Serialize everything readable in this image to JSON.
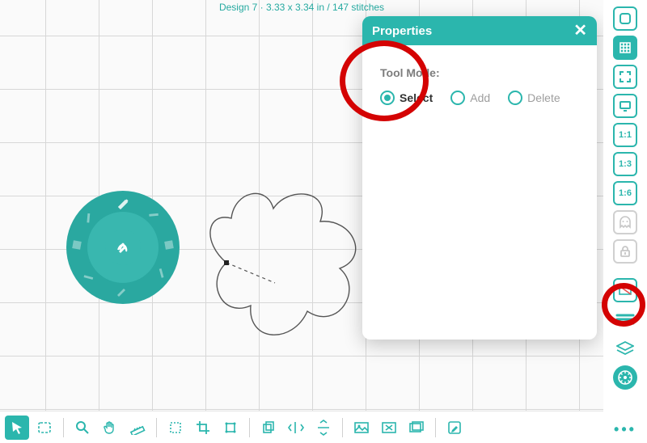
{
  "design_info": "Design 7 · 3.33 x 3.34 in / 147 stitches",
  "panel": {
    "title": "Properties",
    "tool_mode_label": "Tool Mode:",
    "modes": [
      {
        "label": "Select",
        "selected": true
      },
      {
        "label": "Add",
        "selected": false
      },
      {
        "label": "Delete",
        "selected": false
      }
    ]
  },
  "side_tools": [
    {
      "name": "outline-box",
      "label": "",
      "type": "rect"
    },
    {
      "name": "grid",
      "label": "",
      "type": "grid",
      "active": true
    },
    {
      "name": "fit-screen",
      "label": "",
      "type": "fit"
    },
    {
      "name": "monitor",
      "label": "",
      "type": "monitor"
    },
    {
      "name": "zoom-1-1",
      "label": "1:1",
      "type": "text"
    },
    {
      "name": "zoom-1-3",
      "label": "1:3",
      "type": "text"
    },
    {
      "name": "zoom-1-6",
      "label": "1:6",
      "type": "text"
    },
    {
      "name": "ghost",
      "label": "",
      "type": "ghost"
    },
    {
      "name": "lock",
      "label": "",
      "type": "lock"
    },
    {
      "name": "swatch",
      "label": "",
      "type": "swatch"
    },
    {
      "name": "lines",
      "label": "",
      "type": "lines"
    },
    {
      "name": "layers",
      "label": "",
      "type": "layers"
    },
    {
      "name": "wheel",
      "label": "",
      "type": "wheelic"
    }
  ],
  "bottom_tools": [
    "cursor",
    "lasso",
    "sep",
    "zoom",
    "hand",
    "ruler",
    "sep",
    "marquee",
    "crop",
    "transform",
    "sep",
    "duplicate",
    "flip-h",
    "flip-v",
    "sep",
    "image",
    "image-x",
    "image-stack",
    "sep",
    "edit"
  ],
  "wheel_center": {
    "left": "pencil",
    "mid": "split",
    "right": "curve"
  }
}
